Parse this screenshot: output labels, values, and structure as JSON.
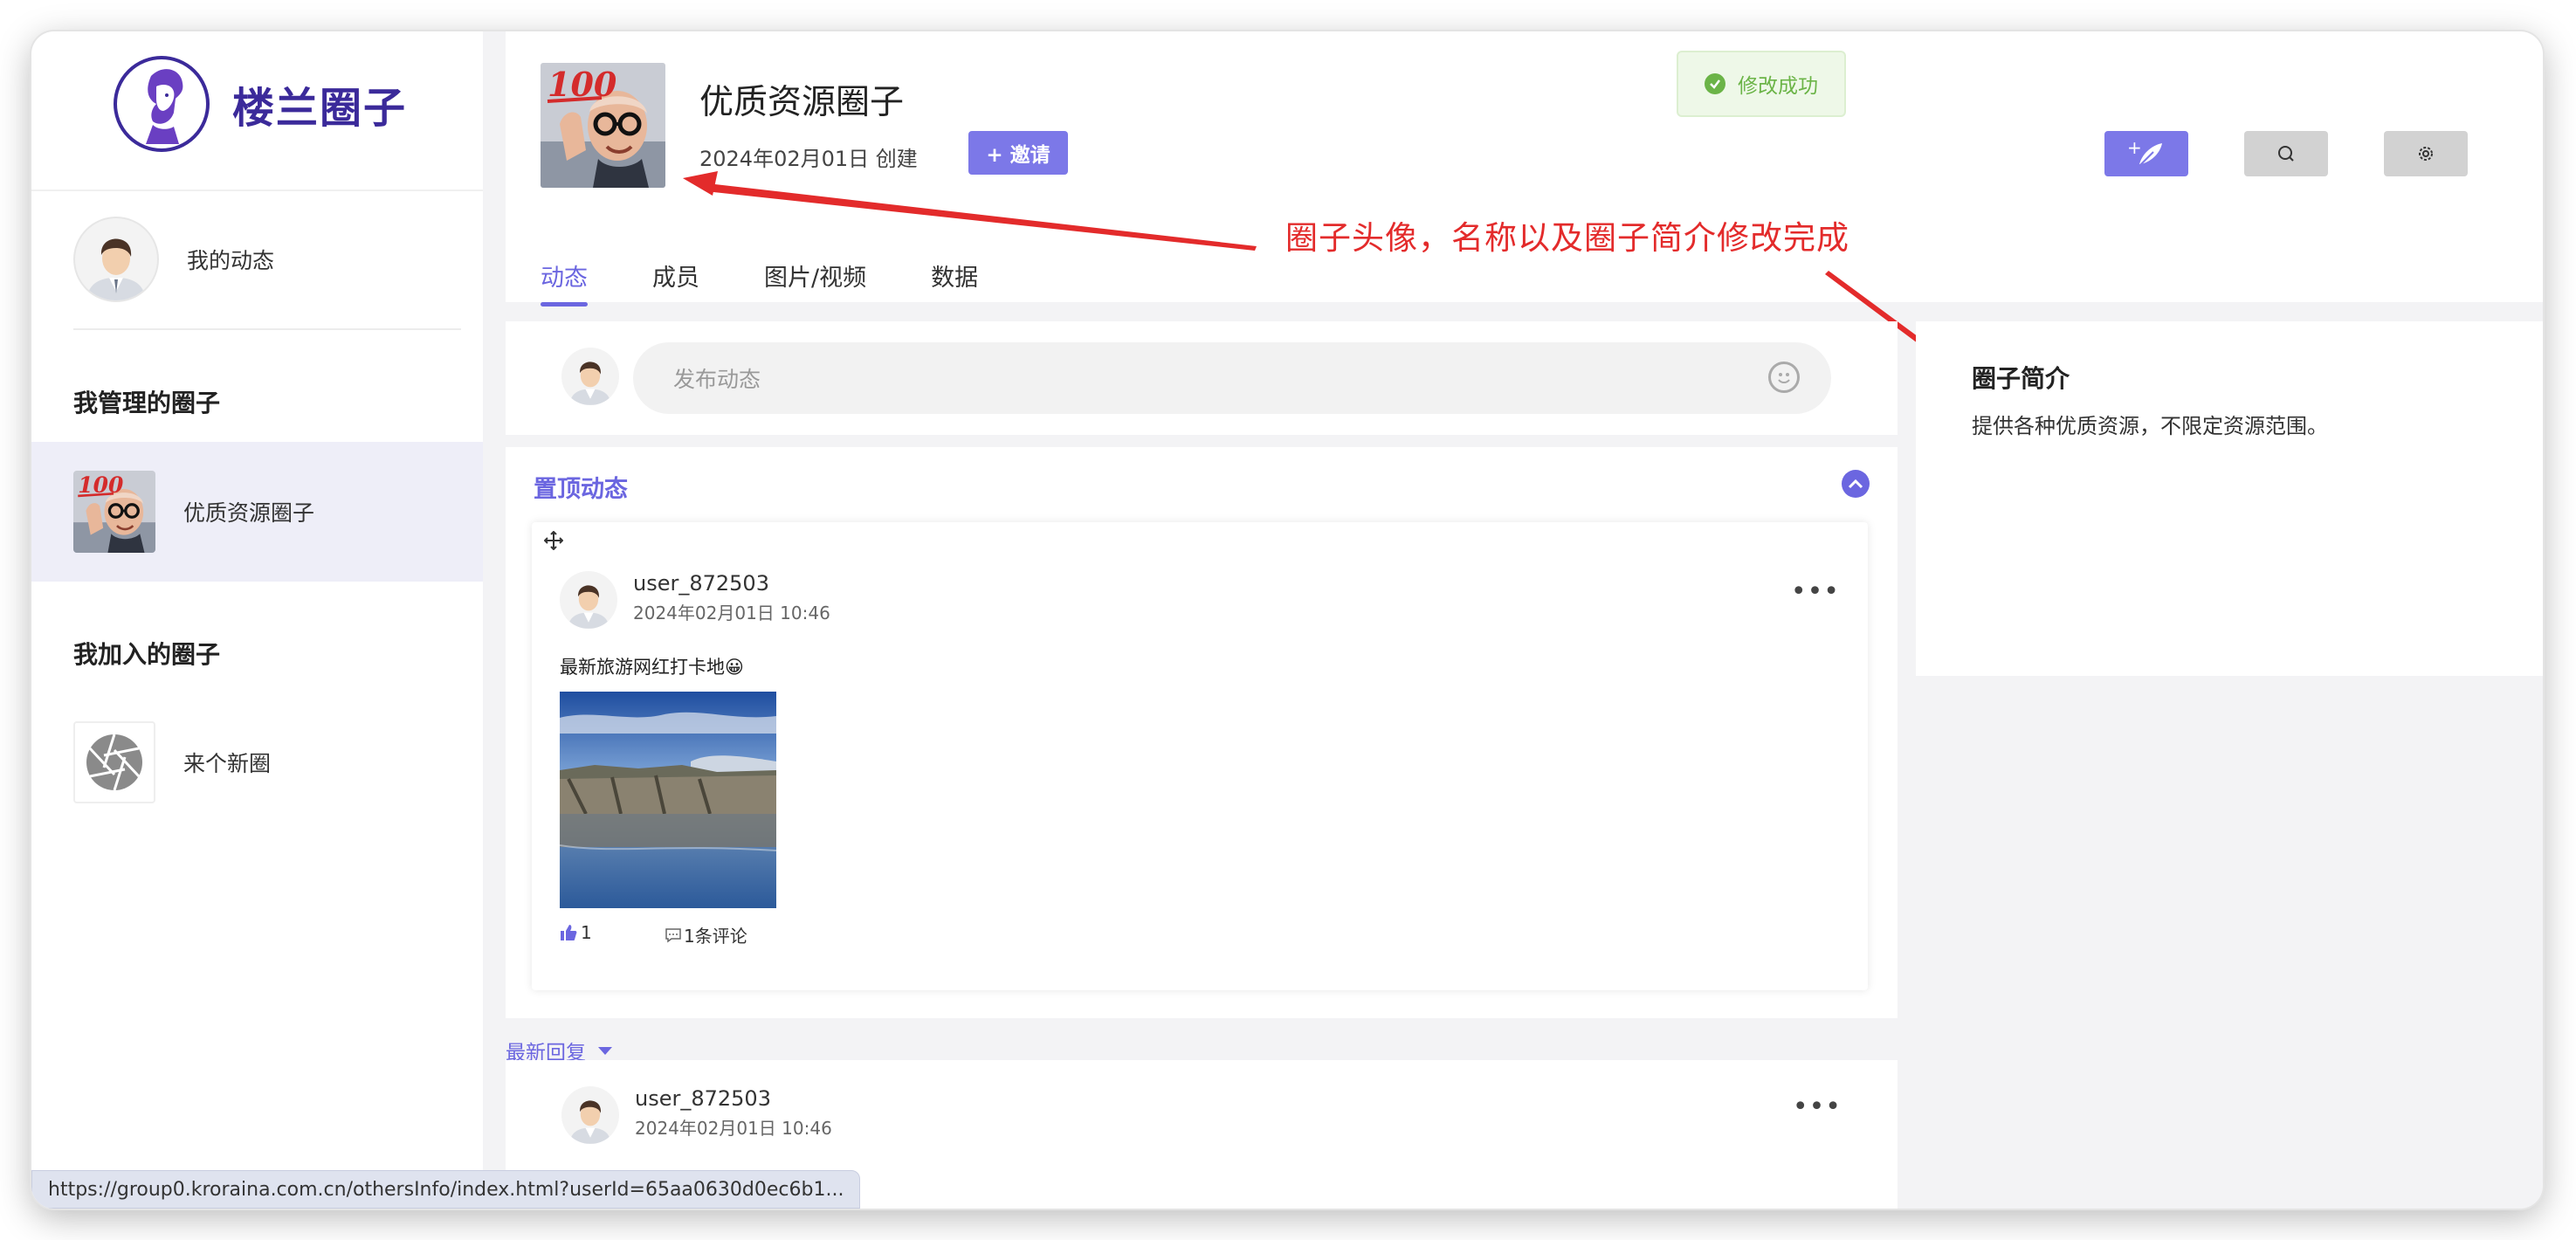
{
  "brand": {
    "name": "楼兰圈子"
  },
  "sidebar": {
    "my_feed_label": "我的动态",
    "managed_title": "我管理的圈子",
    "managed_items": [
      {
        "label": "优质资源圈子"
      }
    ],
    "joined_title": "我加入的圈子",
    "joined_items": [
      {
        "label": "来个新圈"
      }
    ]
  },
  "group": {
    "name": "优质资源圈子",
    "created": "2024年02月01日 创建",
    "invite_label": "+ 邀请",
    "tabs": [
      {
        "label": "动态"
      },
      {
        "label": "成员"
      },
      {
        "label": "图片/视频"
      },
      {
        "label": "数据"
      }
    ]
  },
  "toast": {
    "message": "修改成功"
  },
  "annotation": {
    "text": "圈子头像，名称以及圈子简介修改完成"
  },
  "composer": {
    "placeholder": "发布动态"
  },
  "pinned": {
    "title": "置顶动态",
    "post": {
      "user": "user_872503",
      "time": "2024年02月01日 10:46",
      "text": "最新旅游网红打卡地😀",
      "likes": "1",
      "comments": "1条评论",
      "more": "•••"
    }
  },
  "latest_reply": {
    "label": "最新回复"
  },
  "post2": {
    "user": "user_872503",
    "time": "2024年02月01日 10:46",
    "more": "•••"
  },
  "intro": {
    "title": "圈子简介",
    "text": "提供各种优质资源，不限定资源范围。"
  },
  "status_url": "https://group0.kroraina.com.cn/othersInfo/index.html?userId=65aa0630d0ec6b1...",
  "colors": {
    "accent": "#6b66e0",
    "brand": "#3b2a9a",
    "annotation": "#e32b2b",
    "success": "#6bb447"
  }
}
